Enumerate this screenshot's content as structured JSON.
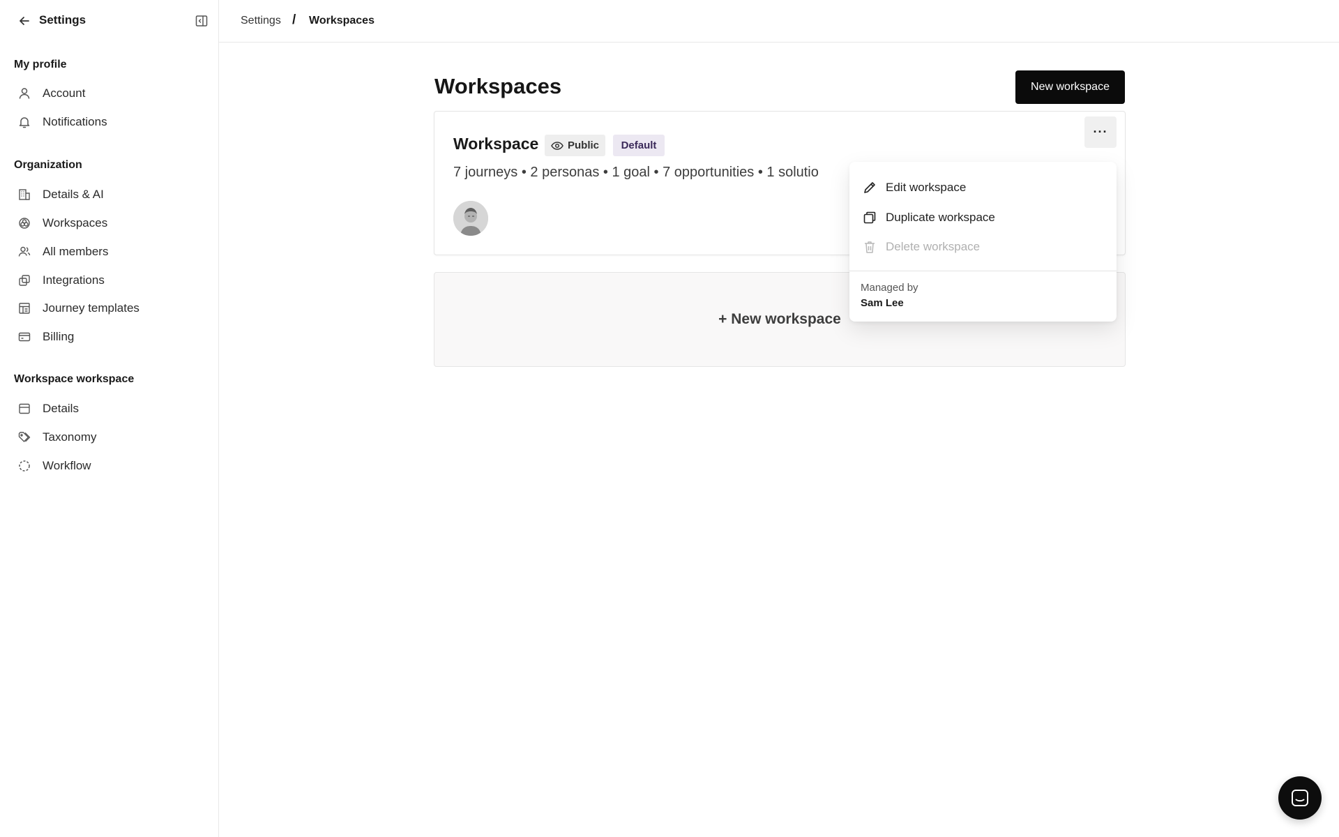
{
  "sidebar": {
    "title": "Settings",
    "sections": [
      {
        "heading": "My profile",
        "items": [
          {
            "label": "Account",
            "icon": "user-icon"
          },
          {
            "label": "Notifications",
            "icon": "bell-icon"
          }
        ]
      },
      {
        "heading": "Organization",
        "items": [
          {
            "label": "Details & AI",
            "icon": "building-icon"
          },
          {
            "label": "Workspaces",
            "icon": "workspaces-icon"
          },
          {
            "label": "All members",
            "icon": "users-icon"
          },
          {
            "label": "Integrations",
            "icon": "integrations-icon"
          },
          {
            "label": "Journey templates",
            "icon": "template-icon"
          },
          {
            "label": "Billing",
            "icon": "credit-card-icon"
          }
        ]
      },
      {
        "heading": "Workspace workspace",
        "items": [
          {
            "label": "Details",
            "icon": "details-icon"
          },
          {
            "label": "Taxonomy",
            "icon": "tags-icon"
          },
          {
            "label": "Workflow",
            "icon": "workflow-icon"
          }
        ]
      }
    ]
  },
  "breadcrumb": {
    "parent": "Settings",
    "separator": "/",
    "current": "Workspaces"
  },
  "main": {
    "title": "Workspaces",
    "new_button": "New workspace",
    "workspace_card": {
      "name": "Workspace",
      "visibility_badge": "Public",
      "default_badge": "Default",
      "stats": "7 journeys • 2 personas • 1 goal • 7 opportunities • 1 solutio",
      "more_label": "···"
    },
    "add_card_label": "+ New workspace"
  },
  "menu": {
    "items": [
      {
        "label": "Edit workspace",
        "icon": "pencil-icon",
        "disabled": false
      },
      {
        "label": "Duplicate workspace",
        "icon": "copy-icon",
        "disabled": false
      },
      {
        "label": "Delete workspace",
        "icon": "trash-icon",
        "disabled": true
      }
    ],
    "managed_by_label": "Managed by",
    "managed_by_name": "Sam Lee"
  },
  "colors": {
    "primary_button": "#0b0b0b",
    "default_badge_bg": "#ece8f2",
    "public_badge_bg": "#eeeeee"
  }
}
